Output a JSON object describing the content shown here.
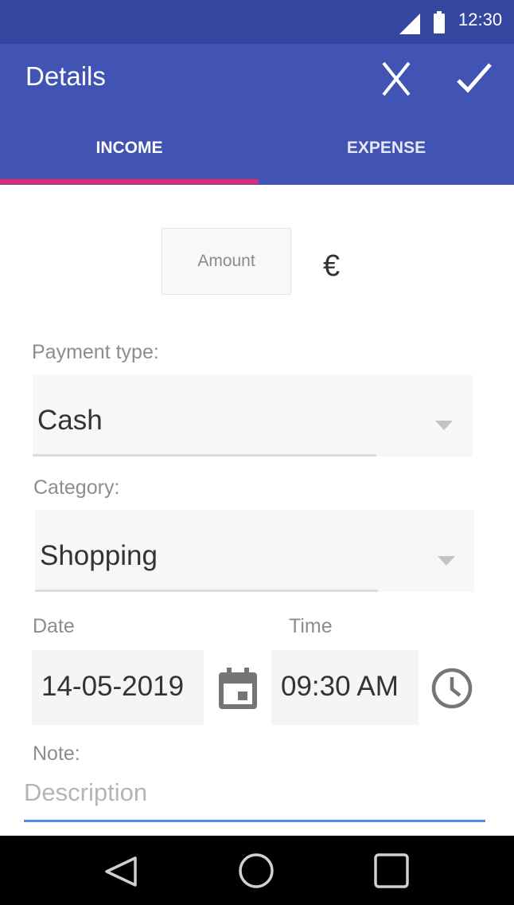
{
  "status_bar": {
    "time": "12:30"
  },
  "app_bar": {
    "title": "Details"
  },
  "tabs": [
    {
      "label": "INCOME",
      "selected": true
    },
    {
      "label": "EXPENSE",
      "selected": false
    }
  ],
  "amount": {
    "placeholder": "Amount",
    "value": "",
    "currency": "€"
  },
  "payment_type": {
    "label": "Payment type:",
    "selected": "Cash"
  },
  "category": {
    "label": "Category:",
    "selected": "Shopping"
  },
  "date": {
    "label": "Date",
    "value": "14-05-2019"
  },
  "time": {
    "label": "Time",
    "value": "09:30  AM"
  },
  "note": {
    "label": "Note:",
    "placeholder": "Description",
    "value": ""
  },
  "colors": {
    "status_bar": "#3446a0",
    "app_bar": "#4153b3",
    "tab_indicator": "#e5286f",
    "description_underline": "#4a8fe0",
    "nav_bar": "#000000"
  },
  "icons": {
    "signal": "signal-icon",
    "battery": "battery-icon",
    "close": "close-icon",
    "confirm": "check-icon",
    "calendar": "calendar-icon",
    "clock": "clock-icon",
    "back": "back-triangle-icon",
    "home": "home-circle-icon",
    "recents": "recents-square-icon"
  }
}
